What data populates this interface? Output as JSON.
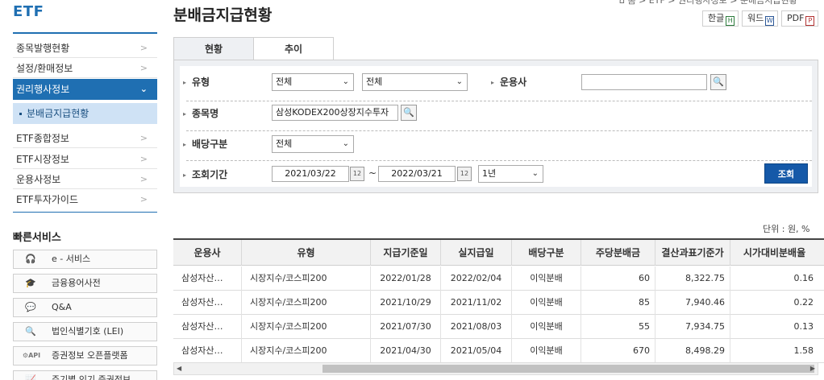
{
  "sidebar": {
    "title": "ETF",
    "items": [
      {
        "label": "종목발행현황",
        "chevron": ">"
      },
      {
        "label": "설정/환매정보",
        "chevron": ">"
      },
      {
        "label": "권리행사정보",
        "chevron": "⌄"
      },
      {
        "label": "ETF종합정보",
        "chevron": ">"
      },
      {
        "label": "ETF시장정보",
        "chevron": ">"
      },
      {
        "label": "운용사정보",
        "chevron": ">"
      },
      {
        "label": "ETF투자가이드",
        "chevron": ">"
      }
    ],
    "active_sub": "분배금지급현황",
    "quick_title": "빠른서비스",
    "quick_items": [
      {
        "label": "e - 서비스",
        "icon": "headset-icon"
      },
      {
        "label": "금융용어사전",
        "icon": "graduation-cap-icon"
      },
      {
        "label": "Q&A",
        "icon": "chat-icon"
      },
      {
        "label": "법인식별기호 (LEI)",
        "icon": "document-search-icon"
      },
      {
        "label": "증권정보 오픈플랫폼",
        "icon": "api-gear-icon",
        "badge": "API"
      },
      {
        "label": "주기별 인기 증권정보",
        "icon": "chart-icon"
      }
    ]
  },
  "header": {
    "title": "분배금지급현황",
    "breadcrumb": "⌂ 홈 > ETF > 권리행사정보 > 분배금지급현황",
    "downloads": [
      {
        "label": "한글",
        "icon": "hwp-file-icon"
      },
      {
        "label": "워드",
        "icon": "word-file-icon"
      },
      {
        "label": "PDF",
        "icon": "pdf-file-icon"
      }
    ]
  },
  "tabs": [
    {
      "label": "현황",
      "active": true
    },
    {
      "label": "추이",
      "active": false
    }
  ],
  "filters": {
    "type_label": "유형",
    "type_select1": "전체",
    "type_select2": "전체",
    "company_label": "운용사",
    "company_value": "",
    "name_label": "종목명",
    "name_value": "삼성KODEX200상장지수투자",
    "dividend_label": "배당구분",
    "dividend_value": "전체",
    "period_label": "조회기간",
    "date_from": "2021/03/22",
    "date_to": "2022/03/21",
    "tilde": "~",
    "period_value": "1년",
    "query_button": "조회"
  },
  "table": {
    "unit": "단위 : 원, %",
    "columns": [
      "운용사",
      "유형",
      "지급기준일",
      "실지급일",
      "배당구분",
      "주당분배금",
      "결산과표기준가",
      "시가대비분배율"
    ],
    "rows": [
      [
        "삼성자산…",
        "시장지수/코스피200",
        "2022/01/28",
        "2022/02/04",
        "이익분배",
        "60",
        "8,322.75",
        "0.16"
      ],
      [
        "삼성자산…",
        "시장지수/코스피200",
        "2021/10/29",
        "2021/11/02",
        "이익분배",
        "85",
        "7,940.46",
        "0.22"
      ],
      [
        "삼성자산…",
        "시장지수/코스피200",
        "2021/07/30",
        "2021/08/03",
        "이익분배",
        "55",
        "7,934.75",
        "0.13"
      ],
      [
        "삼성자산…",
        "시장지수/코스피200",
        "2021/04/30",
        "2021/05/04",
        "이익분배",
        "670",
        "8,498.29",
        "1.58"
      ]
    ]
  }
}
